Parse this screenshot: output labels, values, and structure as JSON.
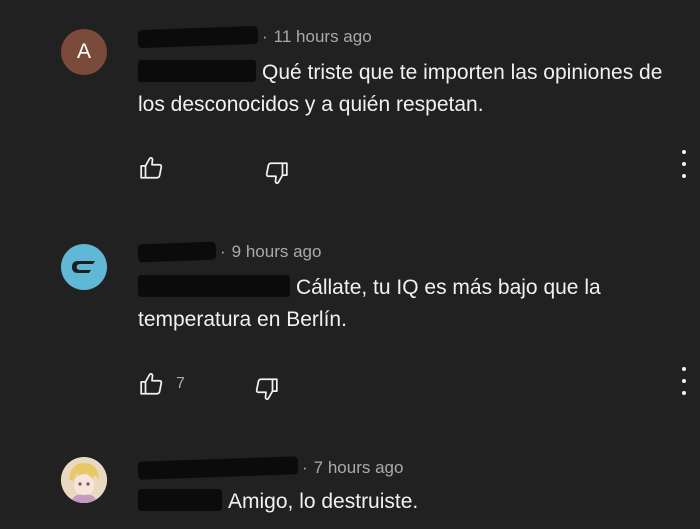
{
  "comments": [
    {
      "avatar_letter": "A",
      "timestamp": "11 hours ago",
      "text": "Qué triste que te importen las opiniones de los desconocidos y a quién respetan.",
      "likes": ""
    },
    {
      "timestamp": "9 hours ago",
      "text": "Cállate, tu IQ es más bajo que la temperatura en Berlín.",
      "likes": "7"
    },
    {
      "timestamp": "7 hours ago",
      "text": "Amigo, lo destruiste.",
      "likes": ""
    }
  ],
  "icons": {
    "like": "thumbs-up-icon",
    "dislike": "thumbs-down-icon",
    "more": "more-vertical-icon"
  },
  "colors": {
    "background": "#212121",
    "text": "#f1f1f1",
    "meta": "#aaaaaa",
    "avatar_letter_bg": "#7a4a3a",
    "avatar_logo_bg": "#5fb8d6"
  }
}
